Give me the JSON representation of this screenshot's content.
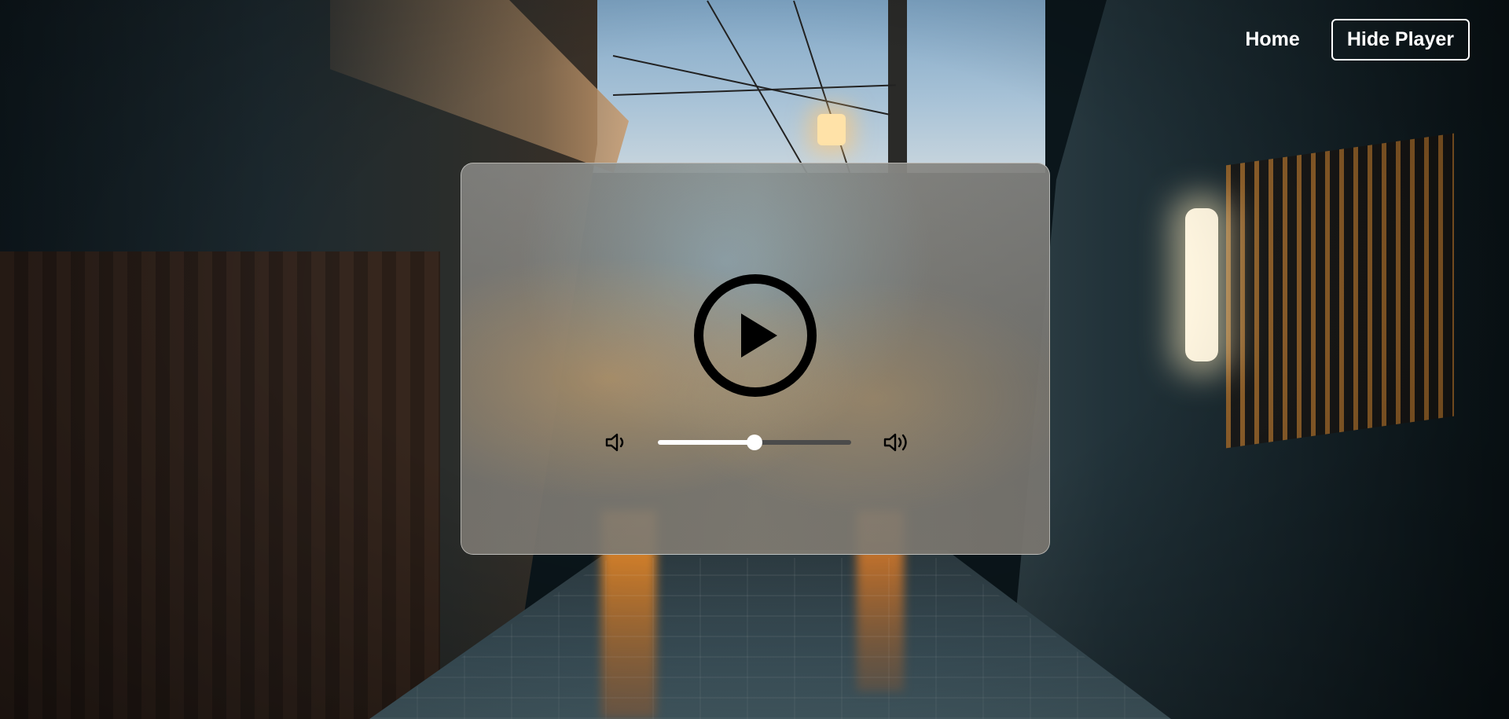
{
  "nav": {
    "home_label": "Home",
    "hide_player_label": "Hide Player"
  },
  "player": {
    "play_icon": "play-icon",
    "volume_low_icon": "volume-low-icon",
    "volume_high_icon": "volume-high-icon",
    "volume_fraction": 0.5
  },
  "colors": {
    "nav_text": "#ffffff",
    "control": "#000000",
    "slider_fill": "#ffffff",
    "slider_track": "#4b4b4b"
  }
}
